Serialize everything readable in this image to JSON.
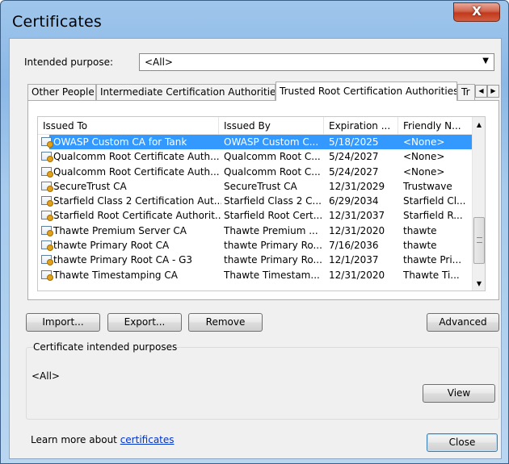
{
  "window": {
    "title": "Certificates",
    "close_glyph": "X"
  },
  "purpose": {
    "label": "Intended purpose:",
    "value": "<All>"
  },
  "tabs": [
    {
      "label": "Other People"
    },
    {
      "label": "Intermediate Certification Authorities"
    },
    {
      "label": "Trusted Root Certification Authorities"
    },
    {
      "label": "Tr"
    }
  ],
  "columns": [
    "Issued To",
    "Issued By",
    "Expiration ...",
    "Friendly N..."
  ],
  "rows": [
    {
      "issued_to": "OWASP Custom CA for Tank",
      "issued_by": "OWASP Custom C...",
      "expiration": "5/18/2025",
      "friendly": "<None>",
      "selected": true
    },
    {
      "issued_to": "Qualcomm Root Certificate Auth...",
      "issued_by": "Qualcomm Root C...",
      "expiration": "5/24/2027",
      "friendly": "<None>"
    },
    {
      "issued_to": "Qualcomm Root Certificate Auth...",
      "issued_by": "Qualcomm Root C...",
      "expiration": "5/24/2027",
      "friendly": "<None>"
    },
    {
      "issued_to": "SecureTrust CA",
      "issued_by": "SecureTrust CA",
      "expiration": "12/31/2029",
      "friendly": "Trustwave"
    },
    {
      "issued_to": "Starfield Class 2 Certification Aut...",
      "issued_by": "Starfield Class 2 C...",
      "expiration": "6/29/2034",
      "friendly": "Starfield Cl..."
    },
    {
      "issued_to": "Starfield Root Certificate Authorit...",
      "issued_by": "Starfield Root Cert...",
      "expiration": "12/31/2037",
      "friendly": "Starfield R..."
    },
    {
      "issued_to": "Thawte Premium Server CA",
      "issued_by": "Thawte Premium ...",
      "expiration": "12/31/2020",
      "friendly": "thawte"
    },
    {
      "issued_to": "thawte Primary Root CA",
      "issued_by": "thawte Primary Ro...",
      "expiration": "7/16/2036",
      "friendly": "thawte"
    },
    {
      "issued_to": "thawte Primary Root CA - G3",
      "issued_by": "thawte Primary Ro...",
      "expiration": "12/1/2037",
      "friendly": "thawte Pri..."
    },
    {
      "issued_to": "Thawte Timestamping CA",
      "issued_by": "Thawte Timestam...",
      "expiration": "12/31/2020",
      "friendly": "Thawte Ti..."
    }
  ],
  "buttons": {
    "import": "Import...",
    "export": "Export...",
    "remove": "Remove",
    "advanced": "Advanced",
    "view": "View",
    "close": "Close"
  },
  "purposes_group": {
    "title": "Certificate intended purposes",
    "value": "<All>"
  },
  "learn": {
    "prefix": "Learn more about ",
    "link": "certificates"
  },
  "icons": {
    "cert": "certificate-icon",
    "scroll_up": "scroll-up-arrow-icon",
    "scroll_down": "scroll-down-arrow-icon"
  },
  "colors": {
    "selection": "#3399ff",
    "link": "#0033cc",
    "close_button": "#c2391d"
  }
}
